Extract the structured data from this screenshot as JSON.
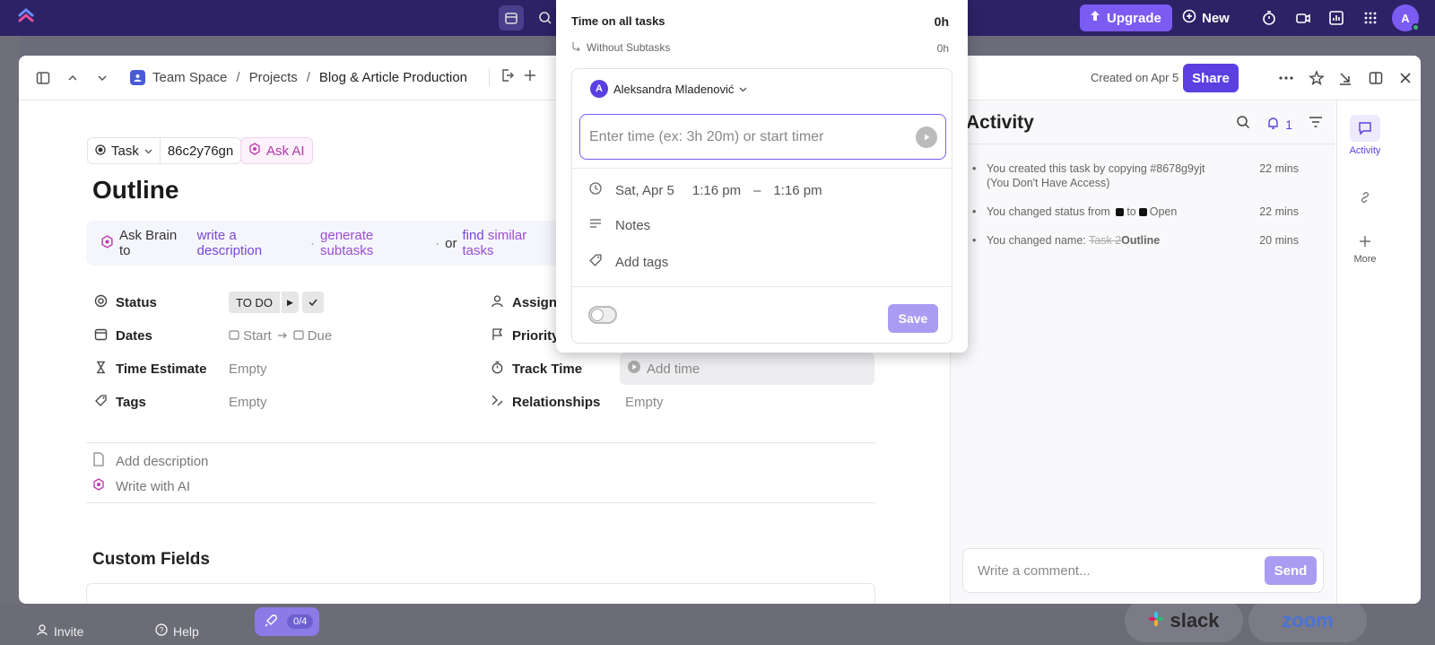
{
  "topbar": {
    "upgrade_label": "Upgrade",
    "new_label": "New",
    "avatar_initial": "A",
    "accent": "#2d2266"
  },
  "footer": {
    "invite_label": "Invite",
    "help_label": "Help",
    "rocket_count": "0/4",
    "slack_label": "slack",
    "zoom_label": "zoom"
  },
  "breadcrumb": {
    "space": "Team Space",
    "folder": "Projects",
    "list": "Blog & Article Production",
    "sep": "/"
  },
  "header": {
    "created": "Created on Apr 5",
    "share_label": "Share"
  },
  "task": {
    "type_label": "Task",
    "id": "86c2y76gn",
    "ask_ai_label": "Ask AI",
    "title": "Outline"
  },
  "brain": {
    "prefix": "Ask Brain to",
    "link1": "write a description",
    "link2": "generate subtasks",
    "or": "or",
    "link3_a": "find",
    "link3_b": "similar tasks",
    "dot": "·"
  },
  "props": {
    "status_label": "Status",
    "status_value": "TO DO",
    "dates_label": "Dates",
    "start_label": "Start",
    "due_label": "Due",
    "estimate_label": "Time Estimate",
    "estimate_value": "Empty",
    "tags_label": "Tags",
    "tags_value": "Empty",
    "assignees_label": "Assignees",
    "priority_label": "Priority",
    "track_label": "Track Time",
    "track_value": "Add time",
    "relationships_label": "Relationships",
    "relationships_value": "Empty"
  },
  "description": {
    "add_label": "Add description",
    "ai_label": "Write with AI"
  },
  "custom_fields": {
    "title": "Custom Fields"
  },
  "activity": {
    "title": "Activity",
    "notification_count": "1",
    "items": [
      {
        "text": "You created this task by copying #8678g9yjt (You Don't Have Access)",
        "time": "22 mins"
      },
      {
        "prefix": "You changed status from",
        "to": "to",
        "new_status": "Open",
        "time": "22 mins"
      },
      {
        "prefix": "You changed name:",
        "old": "Task 2",
        "new": "Outline",
        "time": "20 mins"
      }
    ],
    "comment_placeholder": "Write a comment...",
    "send_label": "Send"
  },
  "rail": {
    "activity_label": "Activity",
    "more_label": "More"
  },
  "timer_popover": {
    "all_tasks_label": "Time on all tasks",
    "all_tasks_value": "0h",
    "without_subtasks_label": "Without Subtasks",
    "without_subtasks_value": "0h",
    "user_name": "Aleksandra Mladenović",
    "user_initial": "A",
    "time_placeholder": "Enter time (ex: 3h 20m) or start timer",
    "date": "Sat, Apr 5",
    "start_time": "1:16 pm",
    "dash": "–",
    "end_time": "1:16 pm",
    "notes_label": "Notes",
    "tags_label": "Add tags",
    "save_label": "Save"
  }
}
